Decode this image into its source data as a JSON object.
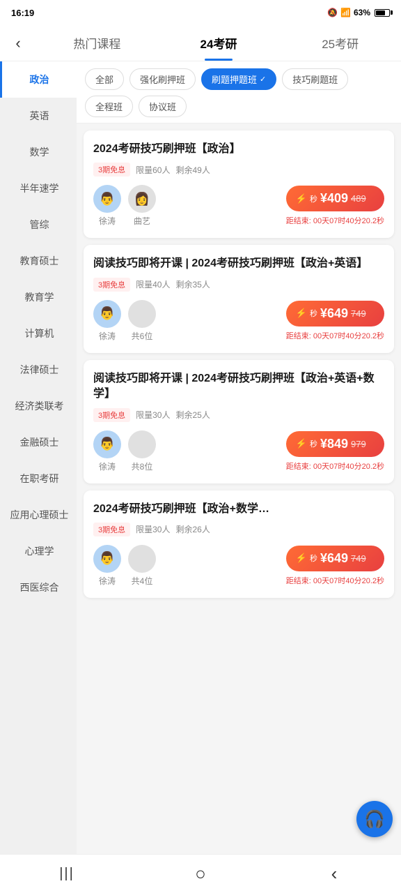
{
  "statusBar": {
    "time": "16:19",
    "battery": "63%"
  },
  "header": {
    "backIcon": "‹",
    "tabs": [
      {
        "id": "hot",
        "label": "热门课程",
        "active": false
      },
      {
        "id": "24",
        "label": "24考研",
        "active": true
      },
      {
        "id": "25",
        "label": "25考研",
        "active": false
      }
    ]
  },
  "sidebar": {
    "items": [
      {
        "id": "zhengzhi",
        "label": "政治",
        "active": true
      },
      {
        "id": "yingyu",
        "label": "英语",
        "active": false
      },
      {
        "id": "shuxue",
        "label": "数学",
        "active": false
      },
      {
        "id": "banniansuxue",
        "label": "半年速学",
        "active": false
      },
      {
        "id": "guanzong",
        "label": "管综",
        "active": false
      },
      {
        "id": "jiaoyushuoshi",
        "label": "教育硕士",
        "active": false
      },
      {
        "id": "jiaoyuxue",
        "label": "教育学",
        "active": false
      },
      {
        "id": "jisuanji",
        "label": "计算机",
        "active": false
      },
      {
        "id": "falvshuoshi",
        "label": "法律硕士",
        "active": false
      },
      {
        "id": "jingjiliankaow",
        "label": "经济类联考",
        "active": false
      },
      {
        "id": "rongshuoshi",
        "label": "金融硕士",
        "active": false
      },
      {
        "id": "zaizhi",
        "label": "在职考研",
        "active": false
      },
      {
        "id": "xinlishuoshi",
        "label": "应用心理硕士",
        "active": false
      },
      {
        "id": "xinlixue",
        "label": "心理学",
        "active": false
      },
      {
        "id": "xiyizhonghe",
        "label": "西医综合",
        "active": false
      }
    ]
  },
  "filters": {
    "row1": [
      {
        "id": "all",
        "label": "全部",
        "selected": false
      },
      {
        "id": "qianghua",
        "label": "强化刷押班",
        "selected": false
      },
      {
        "id": "shuati",
        "label": "刷题押题班",
        "selected": true
      }
    ],
    "row2": [
      {
        "id": "jiqiao",
        "label": "技巧刷题班",
        "selected": false
      },
      {
        "id": "quancheng",
        "label": "全程班",
        "selected": false
      },
      {
        "id": "xieyi",
        "label": "协议班",
        "selected": false
      }
    ]
  },
  "courses": [
    {
      "id": 1,
      "title": "2024考研技巧刷押班【政治】",
      "tag": "3期免息",
      "limit": "限量60人",
      "remaining": "剩余49人",
      "teachers": [
        {
          "name": "徐涛",
          "type": "blue"
        },
        {
          "name": "曲艺",
          "type": "gray"
        }
      ],
      "teacherLabel": null,
      "currentPrice": "¥409",
      "originalPrice": "489",
      "countdown": "距结束: 00天07时40分20.2秒"
    },
    {
      "id": 2,
      "title": "阅读技巧即将开课 | 2024考研技巧刷押班【政治+英语】",
      "tag": "3期免息",
      "limit": "限量40人",
      "remaining": "剩余35人",
      "teachers": [
        {
          "name": "徐涛",
          "type": "blue"
        }
      ],
      "teacherLabel": "共6位",
      "currentPrice": "¥649",
      "originalPrice": "749",
      "countdown": "距结束: 00天07时40分20.2秒"
    },
    {
      "id": 3,
      "title": "阅读技巧即将开课 | 2024考研技巧刷押班【政治+英语+数学】",
      "tag": "3期免息",
      "limit": "限量30人",
      "remaining": "剩余25人",
      "teachers": [
        {
          "name": "徐涛",
          "type": "blue"
        }
      ],
      "teacherLabel": "共8位",
      "currentPrice": "¥849",
      "originalPrice": "979",
      "countdown": "距结束: 00天07时40分20.2秒"
    },
    {
      "id": 4,
      "title": "2024考研技巧刷押班【政治+数学…",
      "tag": "3期免息",
      "limit": "限量30人",
      "remaining": "剩余26人",
      "teachers": [
        {
          "name": "徐涛",
          "type": "blue"
        }
      ],
      "teacherLabel": "共4位",
      "currentPrice": "¥649",
      "originalPrice": "749",
      "countdown": "距结束: 00天07时40分20.2秒"
    }
  ],
  "supportButton": {
    "icon": "🎧"
  },
  "bottomNav": {
    "items": [
      {
        "id": "menu",
        "icon": "|||"
      },
      {
        "id": "home",
        "icon": "○"
      },
      {
        "id": "back",
        "icon": "‹"
      }
    ]
  },
  "priceLabel": "秒"
}
